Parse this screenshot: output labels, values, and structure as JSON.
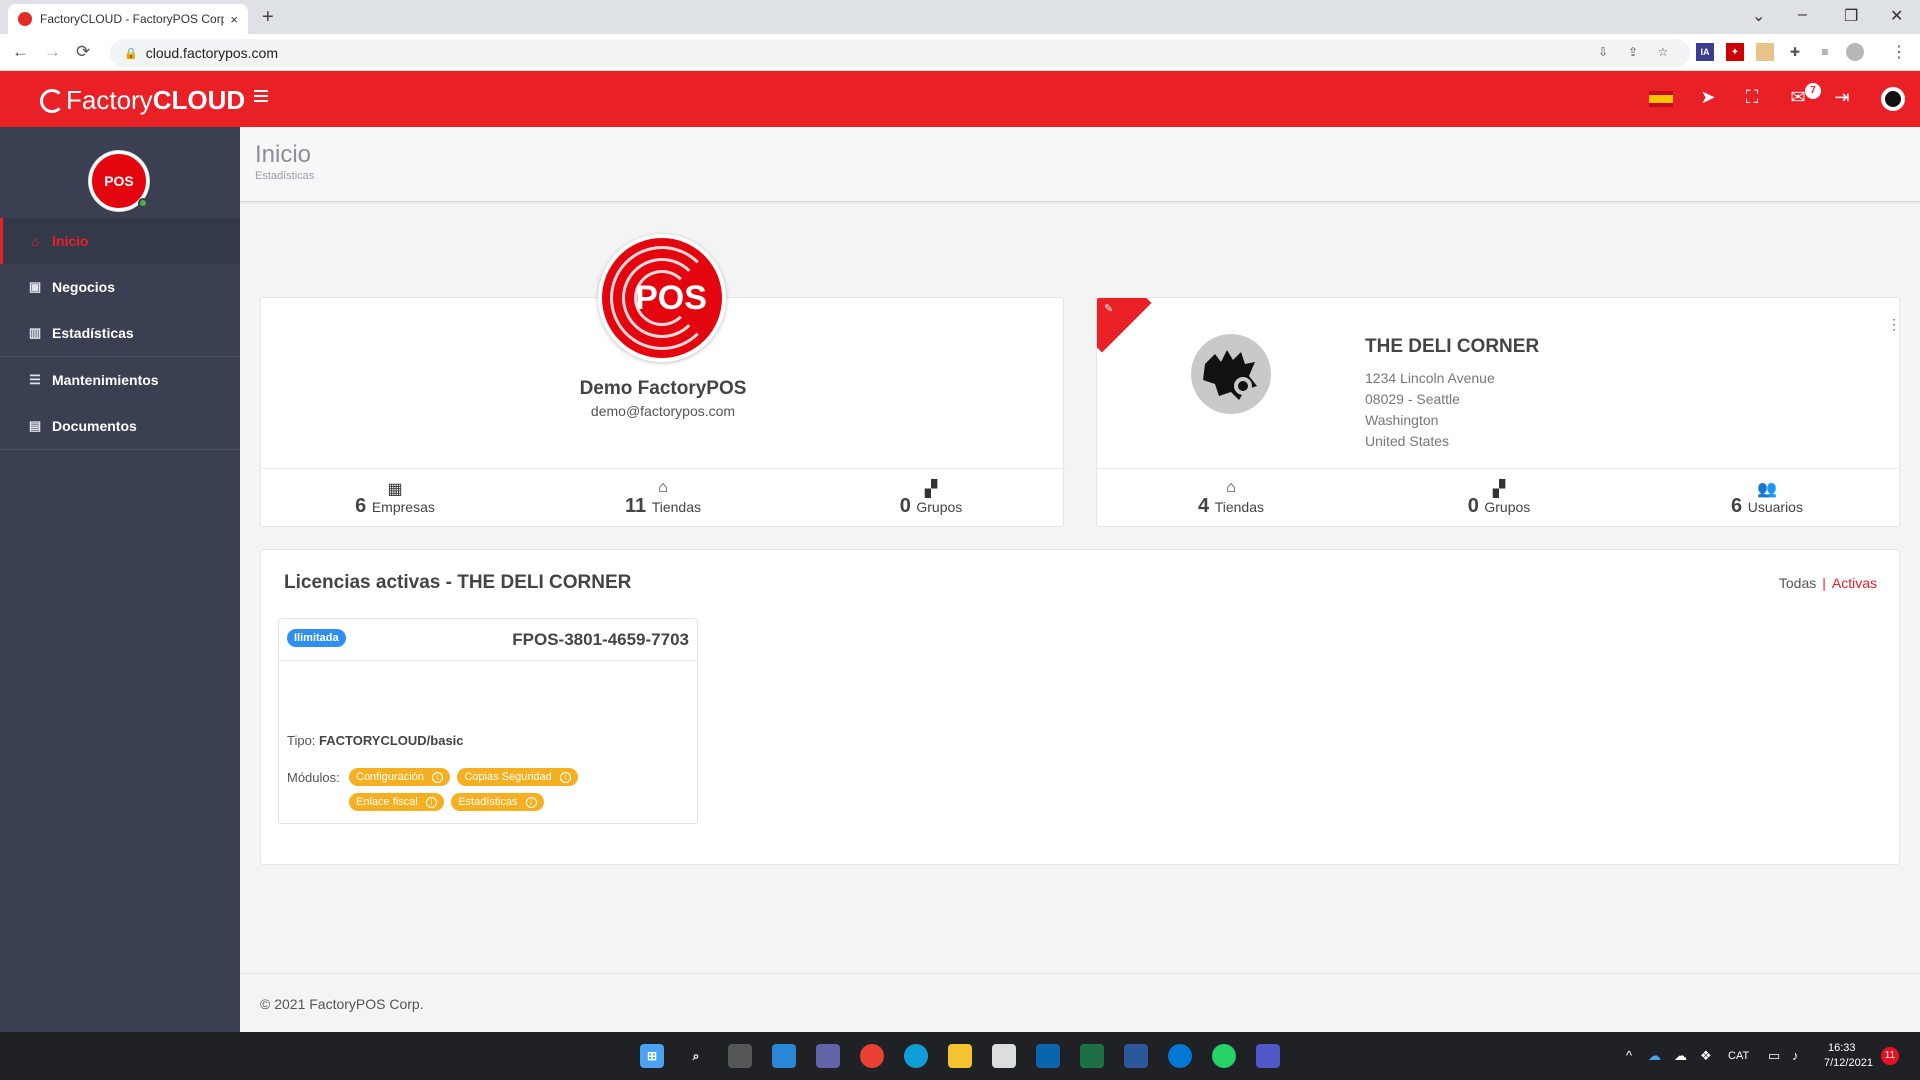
{
  "browser": {
    "tab_title": "FactoryCLOUD - FactoryPOS Corp",
    "close_glyph": "×",
    "new_tab_glyph": "+",
    "url": "cloud.factorypos.com",
    "back_glyph": "←",
    "forward_glyph": "→",
    "reload_glyph": "⟳",
    "minimize_glyph": "–",
    "restore_glyph": "❐",
    "window_close_glyph": "✕",
    "tabs_menu_glyph": "⌄",
    "menu_glyph": "⋮",
    "ext_ia": "IA"
  },
  "header": {
    "brand_factory": "Factory",
    "brand_cloud": "CLOUD",
    "mail_count": "7",
    "icons": [
      "spain-flag-icon",
      "location-arrow-icon",
      "fullscreen-icon",
      "mail-icon",
      "logout-icon",
      "user-avatar-icon"
    ]
  },
  "sidebar": {
    "logo_text": "POS",
    "items": [
      {
        "label": "Inicio",
        "icon": "home-icon",
        "glyph": "⌂"
      },
      {
        "label": "Negocios",
        "icon": "briefcase-icon",
        "glyph": "▣"
      },
      {
        "label": "Estadísticas",
        "icon": "bar-chart-icon",
        "glyph": "▥"
      },
      {
        "label": "Mantenimientos",
        "icon": "list-icon",
        "glyph": "☰"
      },
      {
        "label": "Documentos",
        "icon": "document-icon",
        "glyph": "▤"
      }
    ]
  },
  "page": {
    "title": "Inicio",
    "subtitle": "Estadísticas"
  },
  "company": {
    "avatar_text": "POS",
    "name": "Demo FactoryPOS",
    "email": "demo@factorypos.com",
    "stats": [
      {
        "value": "6",
        "label": "Empresas",
        "icon": "building-icon",
        "glyph": "▦"
      },
      {
        "value": "11",
        "label": "Tiendas",
        "icon": "store-icon",
        "glyph": "⌂"
      },
      {
        "value": "0",
        "label": "Grupos",
        "icon": "boxes-icon",
        "glyph": "▞"
      }
    ]
  },
  "store": {
    "ribbon_glyph": "✎",
    "kebab_glyph": "⋮",
    "name": "THE DELI CORNER",
    "address": [
      "1234 Lincoln Avenue",
      "08029 - Seattle",
      "Washington",
      "United States"
    ],
    "stats": [
      {
        "value": "4",
        "label": "Tiendas",
        "icon": "store-icon",
        "glyph": "⌂"
      },
      {
        "value": "0",
        "label": "Grupos",
        "icon": "boxes-icon",
        "glyph": "▞"
      },
      {
        "value": "6",
        "label": "Usuarios",
        "icon": "users-icon",
        "glyph": "👥"
      }
    ]
  },
  "licenses": {
    "title": "Licencias activas - THE DELI CORNER",
    "filter_all": "Todas",
    "filter_sep": "|",
    "filter_active": "Activas",
    "card": {
      "badge": "Ilimitada",
      "code": "FPOS-3801-4659-7703",
      "tipo_label": "Tipo:",
      "tipo_value": "FACTORYCLOUD/basic",
      "modulos_label": "Módulos:",
      "info_glyph": "i",
      "modules": [
        "Configuración",
        "Copias Seguridad",
        "Enlace fiscal",
        "Estadísticas"
      ]
    }
  },
  "footer": {
    "text": "© 2021 FactoryPOS Corp."
  },
  "taskbar": {
    "lang": "CAT",
    "time": "16:33",
    "date": "7/12/2021",
    "notifications": "11"
  }
}
